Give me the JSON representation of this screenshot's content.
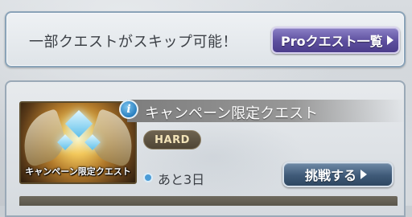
{
  "banner": {
    "text": "一部クエストがスキップ可能！",
    "pro_button_label": "Proクエスト一覧",
    "pro_button_icon": "chevron-right-icon"
  },
  "quest": {
    "thumbnail_label": "キャンペーン限定クエスト",
    "info_icon": "i",
    "title": "キャンペーン限定クエスト",
    "difficulty": "HARD",
    "remaining": "あと3日",
    "challenge_label": "挑戦する",
    "challenge_icon": "chevron-right-icon"
  },
  "colors": {
    "pro_button": "#5d4f9e",
    "challenge_button": "#3f5a78",
    "info_icon": "#2a7fbf"
  }
}
